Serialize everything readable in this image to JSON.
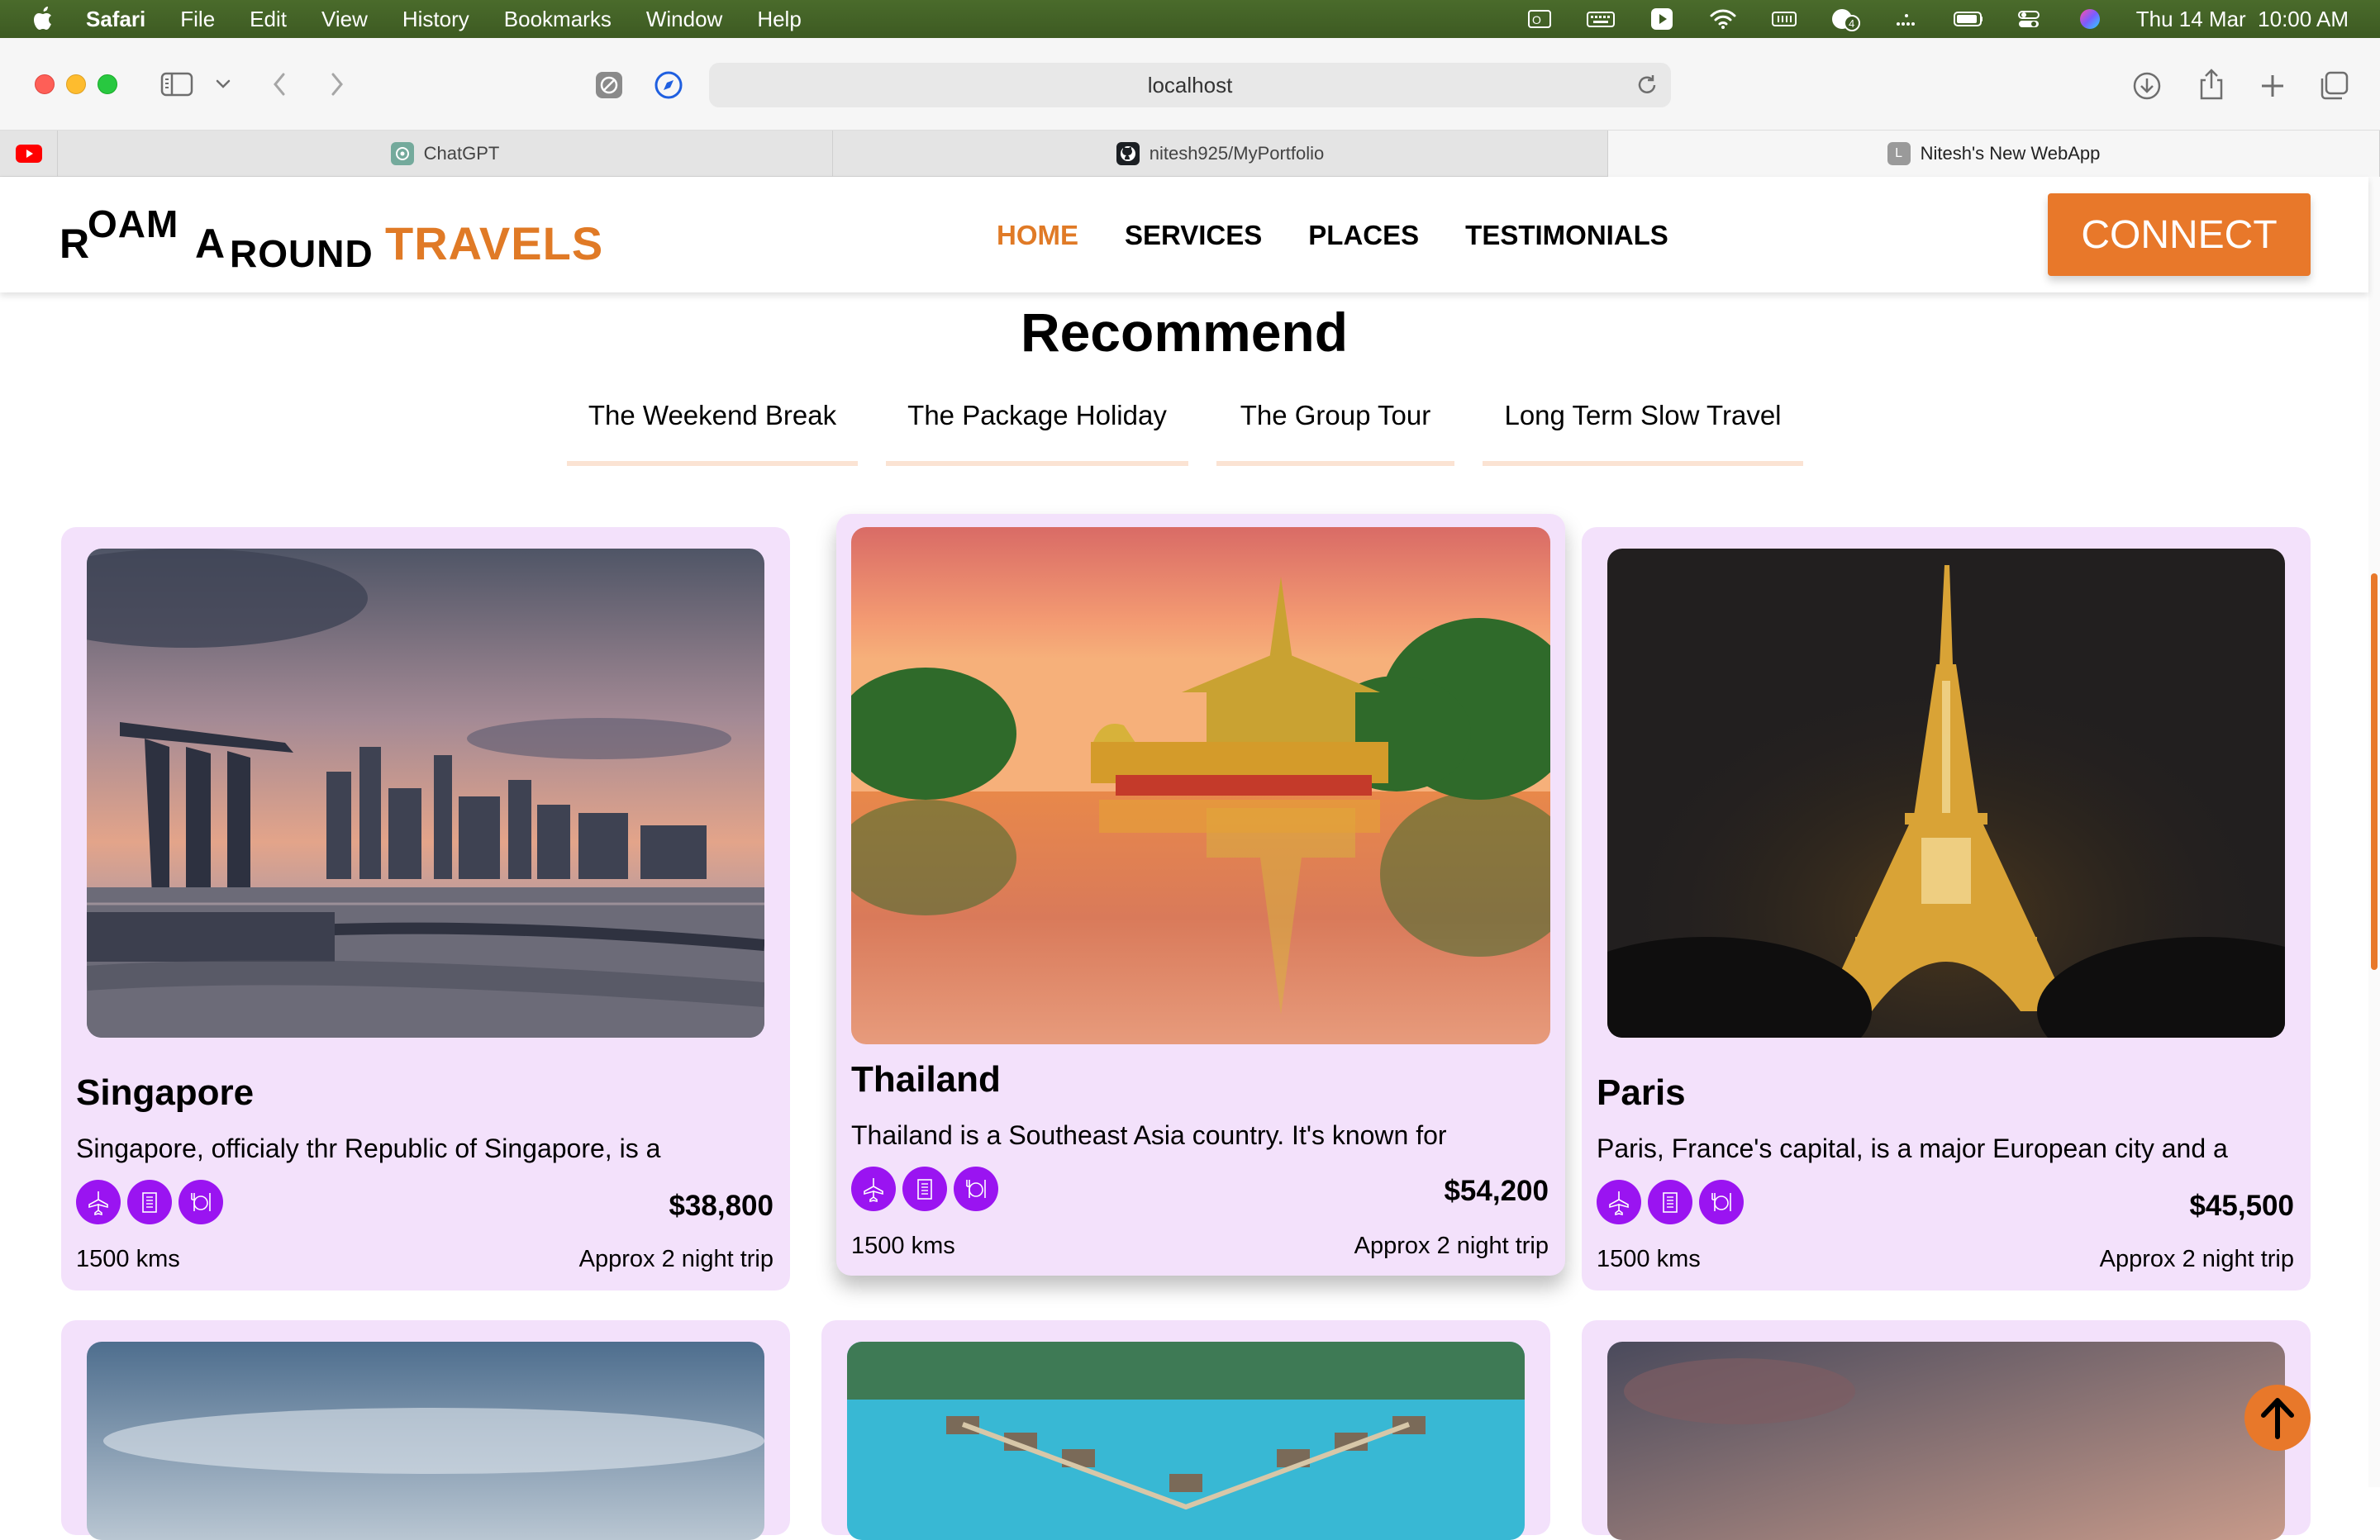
{
  "menubar": {
    "app": "Safari",
    "items": [
      "File",
      "Edit",
      "View",
      "History",
      "Bookmarks",
      "Window",
      "Help"
    ],
    "datetime": "Thu 14 Mar  10:00 AM",
    "notification_count": "4"
  },
  "browser": {
    "url": "localhost",
    "tabs": [
      {
        "label": "ChatGPT",
        "icon": "chatgpt-icon"
      },
      {
        "label": "nitesh925/MyPortfolio",
        "icon": "github-icon"
      },
      {
        "label": "Nitesh's New WebApp",
        "icon": "L",
        "active": true
      }
    ]
  },
  "site": {
    "logo": {
      "r": "R",
      "oam": "OAM",
      "a": "A",
      "round": "ROUND",
      "travels": "TRAVELS"
    },
    "nav": [
      "HOME",
      "SERVICES",
      "PLACES",
      "TESTIMONIALS"
    ],
    "connect": "CONNECT",
    "section_title": "Recommend",
    "filters": [
      "The Weekend Break",
      "The Package Holiday",
      "The Group Tour",
      "Long Term Slow Travel"
    ],
    "cards": [
      {
        "name": "Singapore",
        "desc": "Singapore, officialy thr Republic of Singapore, is a",
        "price": "$38,800",
        "distance": "1500 kms",
        "trip": "Approx 2 night trip"
      },
      {
        "name": "Thailand",
        "desc": "Thailand is a Southeast Asia country. It's known for",
        "price": "$54,200",
        "distance": "1500 kms",
        "trip": "Approx 2 night trip"
      },
      {
        "name": "Paris",
        "desc": "Paris, France's capital, is a major European city and a",
        "price": "$45,500",
        "distance": "1500 kms",
        "trip": "Approx 2 night trip"
      }
    ],
    "card_icons": [
      "airplane-icon",
      "hotel-icon",
      "food-icon"
    ]
  },
  "colors": {
    "accent": "#e8782a",
    "card_bg": "#f3e1fb",
    "icon_purple": "#9a14f1"
  }
}
